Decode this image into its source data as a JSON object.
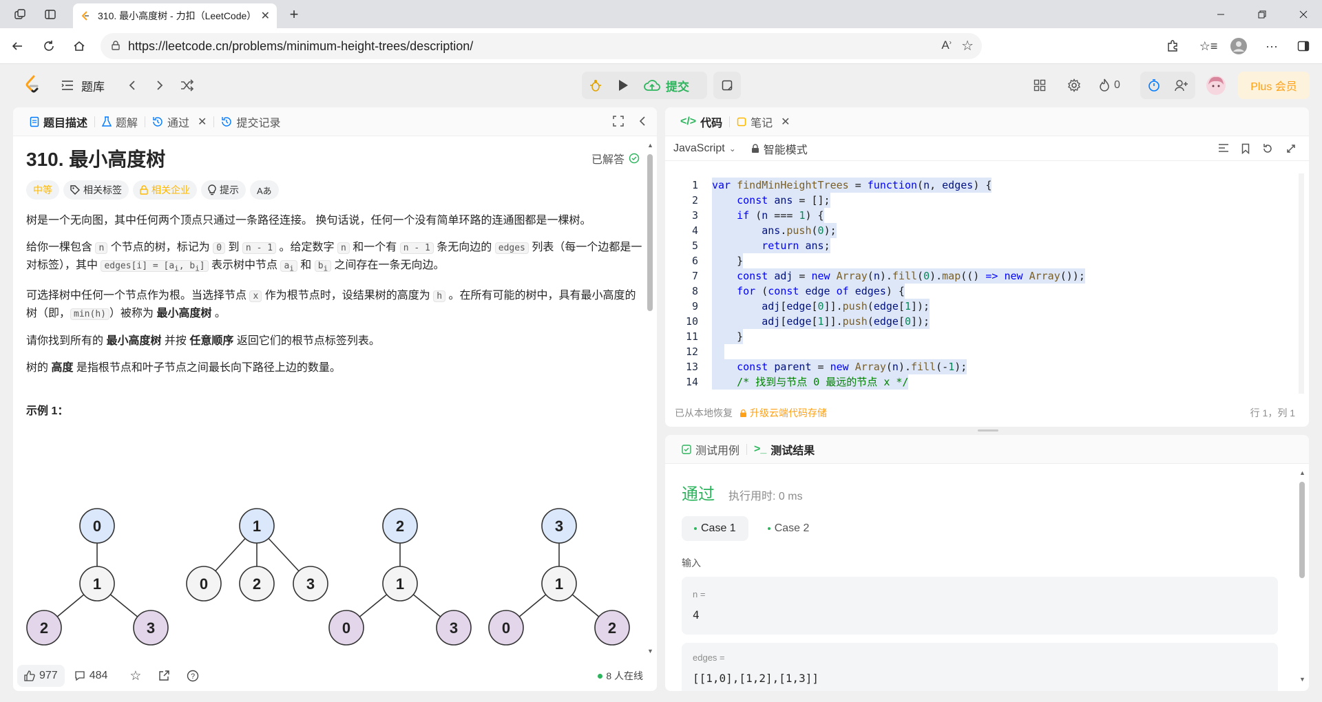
{
  "browser": {
    "tab_title": "310. 最小高度树 - 力扣（LeetCode）",
    "url": "https://leetcode.cn/problems/minimum-height-trees/description/"
  },
  "site": {
    "problem_bank": "题库",
    "submit": "提交",
    "fire_count": "0",
    "plus": "Plus 会员"
  },
  "left_tabs": {
    "description": "题目描述",
    "solution": "题解",
    "passed": "通过",
    "submissions": "提交记录"
  },
  "problem": {
    "title": "310. 最小高度树",
    "solved": "已解答",
    "tags": {
      "difficulty": "中等",
      "related_tags": "相关标签",
      "related_companies": "相关企业",
      "hint": "提示",
      "translate": "Aあ"
    },
    "p1": "树是一个无向图，其中任何两个顶点只通过一条路径连接。 换句话说，任何一个没有简单环路的连通图都是一棵树。",
    "p2": {
      "a": "给你一棵包含 ",
      "n1": "n",
      "b": " 个节点的树，标记为 ",
      "zero": "0",
      "c": " 到 ",
      "nm1": "n - 1",
      "d": " 。给定数字 ",
      "n2": "n",
      "e": " 和一个有 ",
      "nm1b": "n - 1",
      "f": " 条无向边的 ",
      "edges": "edges",
      "g": " 列表（每一个边都是一对标签），其中 ",
      "edge_i": "edges[i] = [a",
      "sub_i": "i",
      "comma": ", b",
      "sub_i2": "i",
      "close": "]",
      "h": " 表示树中节点 ",
      "ai": "a",
      "ai_sub": "i",
      "and": " 和 ",
      "bi": "b",
      "bi_sub": "i",
      "j": " 之间存在一条无向边。"
    },
    "p3": {
      "a": "可选择树中任何一个节点作为根。当选择节点 ",
      "x": "x",
      "b": " 作为根节点时，设结果树的高度为 ",
      "h": "h",
      "c": " 。在所有可能的树中，具有最小高度的树（即，",
      "minh": "min(h)",
      "d": "）被称为 ",
      "bold": "最小高度树",
      "e": " 。"
    },
    "p4": {
      "a": "请你找到所有的 ",
      "b1": "最小高度树",
      "b": " 并按 ",
      "b2": "任意顺序",
      "c": " 返回它们的根节点标签列表。"
    },
    "p5": {
      "a": "树的 ",
      "b1": "高度",
      "b": " 是指根节点和叶子节点之间最长向下路径上边的数量。"
    },
    "example_title": "示例 1：",
    "trees": [
      {
        "root": "0",
        "mid": "1",
        "left": "2",
        "right": "3"
      },
      {
        "root": "1",
        "children": [
          "0",
          "2",
          "3"
        ]
      },
      {
        "root": "2",
        "mid": "1",
        "left": "0",
        "right": "3"
      },
      {
        "root": "3",
        "mid": "1",
        "left": "0",
        "right": "2"
      }
    ]
  },
  "left_footer": {
    "likes": "977",
    "comments": "484",
    "online": "8 人在线"
  },
  "editor": {
    "tab_code": "代码",
    "tab_notes": "笔记",
    "language": "JavaScript",
    "mode": "智能模式",
    "restored": "已从本地恢复",
    "upgrade": "升级云端代码存储",
    "cursor": "行 1，列 1",
    "lines": [
      "1",
      "2",
      "3",
      "4",
      "5",
      "6",
      "7",
      "8",
      "9",
      "10",
      "11",
      "12",
      "13",
      "14"
    ]
  },
  "results": {
    "tab_cases": "测试用例",
    "tab_result": "测试结果",
    "status": "通过",
    "runtime": "执行用时: 0 ms",
    "case1": "Case 1",
    "case2": "Case 2",
    "input_label": "输入",
    "n_label": "n =",
    "n_value": "4",
    "edges_label": "edges =",
    "edges_value": "[[1,0],[1,2],[1,3]]"
  },
  "colors": {
    "accent_green": "#2db55d",
    "orange": "#ffa116",
    "node_blue": "#dbe8fb",
    "node_purple": "#e3d5ea"
  }
}
